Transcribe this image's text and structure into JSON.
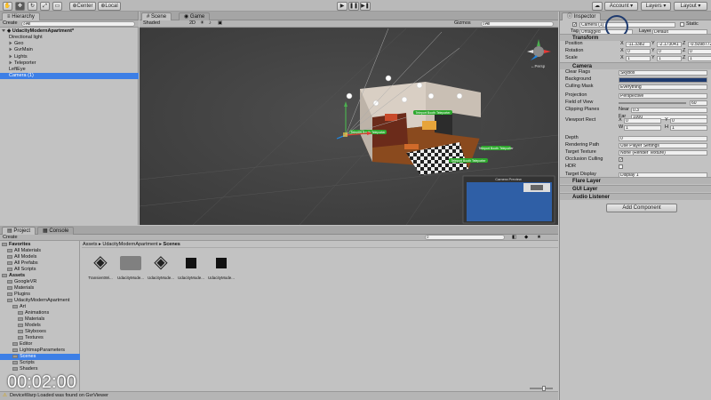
{
  "toolbar": {
    "pivot_label": "Center",
    "space_label": "Local",
    "account_label": "Account",
    "layers_label": "Layers",
    "layout_label": "Layout"
  },
  "hierarchy": {
    "tab": "Hierarchy",
    "create": "Create",
    "search_placeholder": "All",
    "scene_name": "UdacityModernApartment*",
    "items": [
      {
        "label": "Directional light",
        "indent": 1,
        "expandable": false,
        "selected": false
      },
      {
        "label": "Geo",
        "indent": 1,
        "expandable": true,
        "selected": false
      },
      {
        "label": "GvrMain",
        "indent": 1,
        "expandable": true,
        "selected": false
      },
      {
        "label": "Lights",
        "indent": 1,
        "expandable": true,
        "selected": false
      },
      {
        "label": "Teleporter",
        "indent": 1,
        "expandable": true,
        "selected": false
      },
      {
        "label": "LeftEye",
        "indent": 1,
        "expandable": false,
        "selected": false
      },
      {
        "label": "Camera (1)",
        "indent": 1,
        "expandable": false,
        "selected": true
      }
    ]
  },
  "scene": {
    "tab_scene": "Scene",
    "tab_game": "Game",
    "shading": "Shaded",
    "mode_2d": "2D",
    "gizmos": "Gizmos",
    "search": "All",
    "persp": "←Persp",
    "camera_preview": "Camera Preview",
    "labels": [
      "Teleport Booth Teleporter",
      "Teleport Booth Teleporter",
      "Teleport Booth Teleporter",
      "Teleport Booth Teleporter"
    ]
  },
  "project": {
    "tab_project": "Project",
    "tab_console": "Console",
    "create": "Create",
    "breadcrumb": [
      "Assets",
      "UdacityModernApartment",
      "Scenes"
    ],
    "tree": [
      {
        "label": "Favorites",
        "indent": 0,
        "bold": true,
        "selected": false
      },
      {
        "label": "All Materials",
        "indent": 1,
        "bold": false,
        "selected": false
      },
      {
        "label": "All Models",
        "indent": 1,
        "bold": false,
        "selected": false
      },
      {
        "label": "All Prefabs",
        "indent": 1,
        "bold": false,
        "selected": false
      },
      {
        "label": "All Scripts",
        "indent": 1,
        "bold": false,
        "selected": false
      },
      {
        "label": "Assets",
        "indent": 0,
        "bold": true,
        "selected": false
      },
      {
        "label": "GoogleVR",
        "indent": 1,
        "bold": false,
        "selected": false
      },
      {
        "label": "Materials",
        "indent": 1,
        "bold": false,
        "selected": false
      },
      {
        "label": "Plugins",
        "indent": 1,
        "bold": false,
        "selected": false
      },
      {
        "label": "UdacityModernApartment",
        "indent": 1,
        "bold": false,
        "selected": false
      },
      {
        "label": "Art",
        "indent": 2,
        "bold": false,
        "selected": false
      },
      {
        "label": "Animations",
        "indent": 3,
        "bold": false,
        "selected": false
      },
      {
        "label": "Materials",
        "indent": 3,
        "bold": false,
        "selected": false
      },
      {
        "label": "Models",
        "indent": 3,
        "bold": false,
        "selected": false
      },
      {
        "label": "Skyboxes",
        "indent": 3,
        "bold": false,
        "selected": false
      },
      {
        "label": "Textures",
        "indent": 3,
        "bold": false,
        "selected": false
      },
      {
        "label": "Editor",
        "indent": 2,
        "bold": false,
        "selected": false
      },
      {
        "label": "LightmapParameters",
        "indent": 2,
        "bold": false,
        "selected": false
      },
      {
        "label": "Scenes",
        "indent": 2,
        "bold": false,
        "selected": true
      },
      {
        "label": "Scripts",
        "indent": 2,
        "bold": false,
        "selected": false
      },
      {
        "label": "Shaders",
        "indent": 2,
        "bold": false,
        "selected": false
      }
    ],
    "assets": [
      {
        "label": "TransientWi...",
        "kind": "unity"
      },
      {
        "label": "UdacityMode...",
        "kind": "folder"
      },
      {
        "label": "UdacityMode...",
        "kind": "unity"
      },
      {
        "label": "UdacityMode...",
        "kind": "dark"
      },
      {
        "label": "UdacityMode...",
        "kind": "dark"
      }
    ]
  },
  "inspector": {
    "tab": "Inspector",
    "object_name": "Camera (1)",
    "static_label": "Static",
    "tag_label": "Tag",
    "tag_value": "Untagged",
    "layer_label": "Layer",
    "layer_value": "Default",
    "transform": {
      "title": "Transform",
      "position_label": "Position",
      "rotation_label": "Rotation",
      "scale_label": "Scale",
      "position": [
        "-11.3382",
        "-2.173041",
        "-0.5098772"
      ],
      "rotation": [
        "0",
        "0",
        "0"
      ],
      "scale": [
        "1",
        "1",
        "1"
      ]
    },
    "camera": {
      "title": "Camera",
      "fields": [
        {
          "label": "Clear Flags",
          "value": "Skybox"
        },
        {
          "label": "Background",
          "value": ""
        },
        {
          "label": "Culling Mask",
          "value": "Everything"
        },
        {
          "label": "Projection",
          "value": "Perspective"
        },
        {
          "label": "Field of View",
          "value": "60"
        },
        {
          "label": "Clipping Planes",
          "value": ""
        },
        {
          "label": "Viewport Rect",
          "value": ""
        },
        {
          "label": "Depth",
          "value": "0"
        },
        {
          "label": "Rendering Path",
          "value": "Use Player Settings"
        },
        {
          "label": "Target Texture",
          "value": "None (Render Texture)"
        },
        {
          "label": "Occlusion Culling",
          "value": ""
        },
        {
          "label": "HDR",
          "value": ""
        },
        {
          "label": "Target Display",
          "value": "Display 1"
        }
      ],
      "near_label": "Near",
      "near_value": "0.3",
      "far_label": "Far",
      "far_value": "1000",
      "viewport": {
        "x": "0",
        "y": "0",
        "w": "1",
        "h": "1"
      }
    },
    "components": [
      "Flare Layer",
      "GUI Layer",
      "Audio Listener"
    ],
    "add_component": "Add Component",
    "background_color": "#1e3a6e"
  },
  "status": {
    "message": "DeviceWarp Loaded was found on GvrViewer"
  },
  "timer": "00:02:00"
}
